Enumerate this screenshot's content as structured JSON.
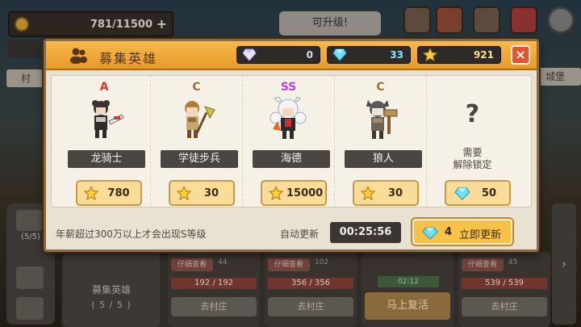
{
  "background": {
    "gold": "781/11500",
    "upgrade_tip": "可升级!",
    "village_left": "村",
    "village_right": "城堡",
    "party_count": "(5/5)",
    "recruit_card": {
      "title": "募集英雄",
      "count": "( 5 / 5 )"
    },
    "slots": [
      {
        "detail": "仔细查看",
        "stat": "44",
        "hp": "192 / 192",
        "go": "去村庄"
      },
      {
        "detail": "仔细查看",
        "stat": "102",
        "hp": "356 / 356",
        "go": "去村庄"
      },
      {
        "detail": "仔细查看",
        "stat": "45",
        "hp": "539 / 539",
        "go": "去村庄"
      }
    ],
    "revive": {
      "timer": "02:12",
      "label": "马上复活"
    }
  },
  "dialog": {
    "title": "募集英雄",
    "currency": {
      "diamond": "0",
      "gem": "33",
      "star": "921"
    },
    "heroes": [
      {
        "grade": "A",
        "grade_class": "A",
        "name": "龙骑士",
        "cost": "780",
        "sprite": "dragon-knight"
      },
      {
        "grade": "C",
        "grade_class": "C",
        "name": "学徒步兵",
        "cost": "30",
        "sprite": "apprentice-infantry"
      },
      {
        "grade": "SS",
        "grade_class": "SS",
        "name": "海德",
        "cost": "15000",
        "sprite": "hyde"
      },
      {
        "grade": "C",
        "grade_class": "C",
        "name": "狼人",
        "cost": "30",
        "sprite": "werewolf"
      }
    ],
    "locked_slot": {
      "symbol": "?",
      "text_line1": "需要",
      "text_line2": "解除锁定",
      "cost": "50"
    },
    "footer_note": "年薪超过300万以上才会出现S等级",
    "auto_refresh_label": "自动更新",
    "auto_refresh_timer": "00:25:56",
    "refresh_button": {
      "cost": "4",
      "label": "立即更新"
    }
  },
  "colors": {
    "accent": "#f4a93a",
    "close": "#e3532f",
    "button_bg": "#f9dc98",
    "panel": "#e9e2d2"
  }
}
